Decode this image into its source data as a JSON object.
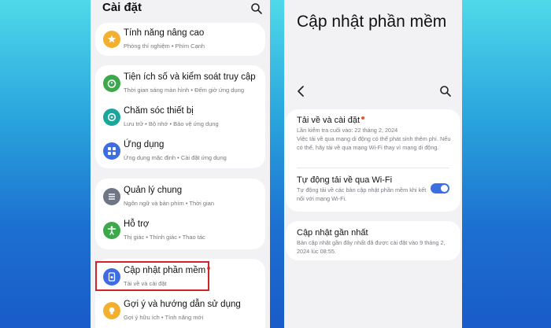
{
  "left": {
    "title": "Cài đặt",
    "items": [
      {
        "title": "Tính năng nâng cao",
        "subtitle": "Phòng thí nghiệm • Phím Cạnh",
        "icon": "star-gear-icon",
        "color": "#f3b02f"
      },
      {
        "title": "Tiện ích số và kiểm soát truy cập",
        "subtitle": "Thời gian sáng màn hình • Đếm giờ ứng dụng",
        "icon": "timer-icon",
        "color": "#3ba84a"
      },
      {
        "title": "Chăm sóc thiết bị",
        "subtitle": "Lưu trữ • Bộ nhớ • Bảo vệ ứng dụng",
        "icon": "refresh-icon",
        "color": "#1aa69a"
      },
      {
        "title": "Ứng dụng",
        "subtitle": "Ứng dụng mặc định • Cài đặt ứng dụng",
        "icon": "apps-grid-icon",
        "color": "#3d6de0"
      },
      {
        "title": "Quản lý chung",
        "subtitle": "Ngôn ngữ và bàn phím • Thời gian",
        "icon": "sliders-icon",
        "color": "#6f7585"
      },
      {
        "title": "Hỗ trợ",
        "subtitle": "Thị giác • Thính giác • Thao tác",
        "icon": "accessibility-icon",
        "color": "#3ba84a"
      },
      {
        "title": "Cập nhật phần mềm",
        "subtitle": "Tải về và cài đặt",
        "icon": "software-update-icon",
        "color": "#3d6de0"
      },
      {
        "title": "Gợi ý và hướng dẫn sử dụng",
        "subtitle": "Gợi ý hữu ích • Tính năng mới",
        "icon": "lightbulb-icon",
        "color": "#f3b02f"
      }
    ]
  },
  "right": {
    "title": "Cập nhật phần mềm",
    "download": {
      "title": "Tải về và cài đặt",
      "last_checked": "Lần kiểm tra cuối vào: 22 tháng 2, 2024",
      "note": "Việc tải về qua mạng di động có thể phát sinh thêm phí. Nếu có thể, hãy tải về qua mạng Wi-Fi thay vì mạng di động."
    },
    "auto_wifi": {
      "title": "Tự động tải về qua Wi-Fi",
      "description": "Tự động tải về các bản cập nhật phần mềm khi kết nối với mạng Wi-Fi.",
      "enabled": true
    },
    "last_update": {
      "title": "Cập nhật gần nhất",
      "description": "Bản cập nhật gần đây nhất đã được cài đặt vào 9 tháng 2, 2024 lúc 08:55."
    }
  },
  "colors": {
    "accent": "#3c6fe0",
    "highlight": "#d2232a",
    "badge": "#e8552b"
  }
}
